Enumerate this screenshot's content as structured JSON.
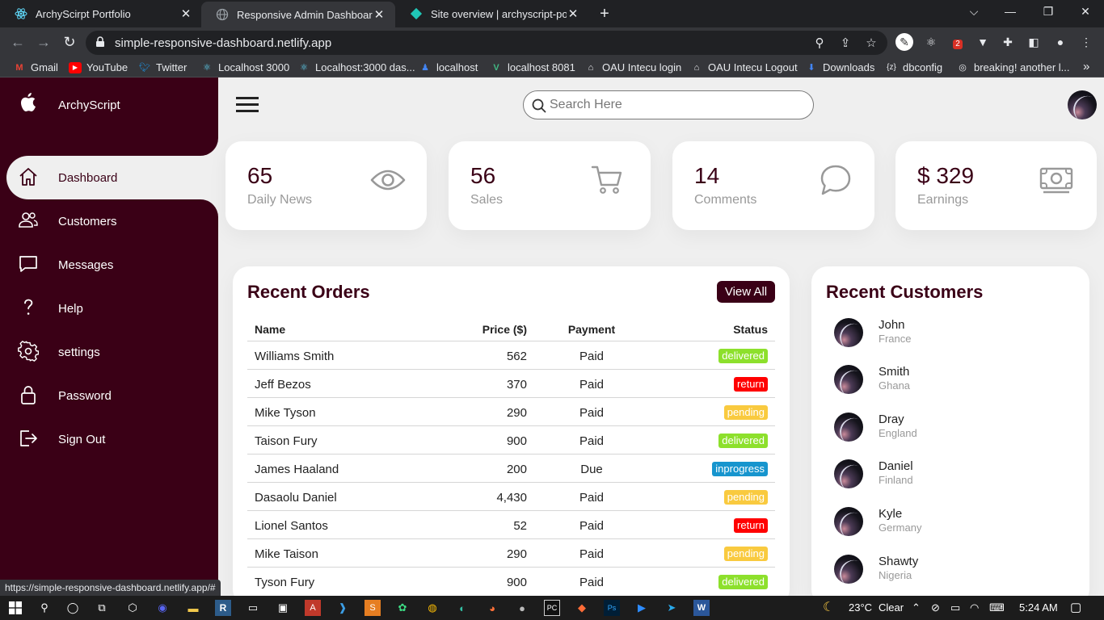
{
  "browser": {
    "tabs": [
      {
        "title": "ArchyScirpt Portfolio",
        "favicon": "react-icon"
      },
      {
        "title": "Responsive Admin Dashboard De",
        "favicon": "globe-icon"
      },
      {
        "title": "Site overview | archyscript-portfo",
        "favicon": "netlify-icon"
      }
    ],
    "url": "simple-responsive-dashboard.netlify.app",
    "bookmarks": [
      "Gmail",
      "YouTube",
      "Twitter",
      "Localhost 3000",
      "Localhost:3000 das...",
      "localhost",
      "localhost 8081",
      "OAU Intecu login",
      "OAU Intecu Logout",
      "Downloads",
      "dbconfig",
      "breaking! another l..."
    ],
    "status_url": "https://simple-responsive-dashboard.netlify.app/#",
    "extension_badge": "2"
  },
  "sidebar": {
    "brand": "ArchyScript",
    "items": [
      {
        "label": "Dashboard"
      },
      {
        "label": "Customers"
      },
      {
        "label": "Messages"
      },
      {
        "label": "Help"
      },
      {
        "label": "settings"
      },
      {
        "label": "Password"
      },
      {
        "label": "Sign Out"
      }
    ]
  },
  "search": {
    "placeholder": "Search Here"
  },
  "cards": [
    {
      "number": "65",
      "label": "Daily News",
      "icon": "eye-icon"
    },
    {
      "number": "56",
      "label": "Sales",
      "icon": "cart-icon"
    },
    {
      "number": "14",
      "label": "Comments",
      "icon": "chat-icon"
    },
    {
      "number": "$ 329",
      "label": "Earnings",
      "icon": "cash-icon"
    }
  ],
  "orders": {
    "title": "Recent Orders",
    "view_all": "View All",
    "columns": {
      "name": "Name",
      "price": "Price ($)",
      "payment": "Payment",
      "status": "Status"
    },
    "rows": [
      {
        "name": "Williams Smith",
        "price": "562",
        "payment": "Paid",
        "status": "delivered"
      },
      {
        "name": "Jeff Bezos",
        "price": "370",
        "payment": "Paid",
        "status": "return"
      },
      {
        "name": "Mike Tyson",
        "price": "290",
        "payment": "Paid",
        "status": "pending"
      },
      {
        "name": "Taison Fury",
        "price": "900",
        "payment": "Paid",
        "status": "delivered"
      },
      {
        "name": "James Haaland",
        "price": "200",
        "payment": "Due",
        "status": "inprogress"
      },
      {
        "name": "Dasaolu Daniel",
        "price": "4,430",
        "payment": "Paid",
        "status": "pending"
      },
      {
        "name": "Lionel Santos",
        "price": "52",
        "payment": "Paid",
        "status": "return"
      },
      {
        "name": "Mike Taison",
        "price": "290",
        "payment": "Paid",
        "status": "pending"
      },
      {
        "name": "Tyson Fury",
        "price": "900",
        "payment": "Paid",
        "status": "delivered"
      }
    ],
    "status_colors": {
      "delivered": "#8de02c",
      "return": "#f00",
      "pending": "#f9ca3f",
      "inprogress": "#1795ce"
    }
  },
  "customers": {
    "title": "Recent Customers",
    "list": [
      {
        "name": "John",
        "country": "France"
      },
      {
        "name": "Smith",
        "country": "Ghana"
      },
      {
        "name": "Dray",
        "country": "England"
      },
      {
        "name": "Daniel",
        "country": "Finland"
      },
      {
        "name": "Kyle",
        "country": "Germany"
      },
      {
        "name": "Shawty",
        "country": "Nigeria"
      }
    ]
  },
  "taskbar": {
    "temperature": "23°C",
    "weather": "Clear",
    "time": "5:24 AM"
  },
  "colors": {
    "primary": "#3a0016",
    "background": "#efefef"
  }
}
